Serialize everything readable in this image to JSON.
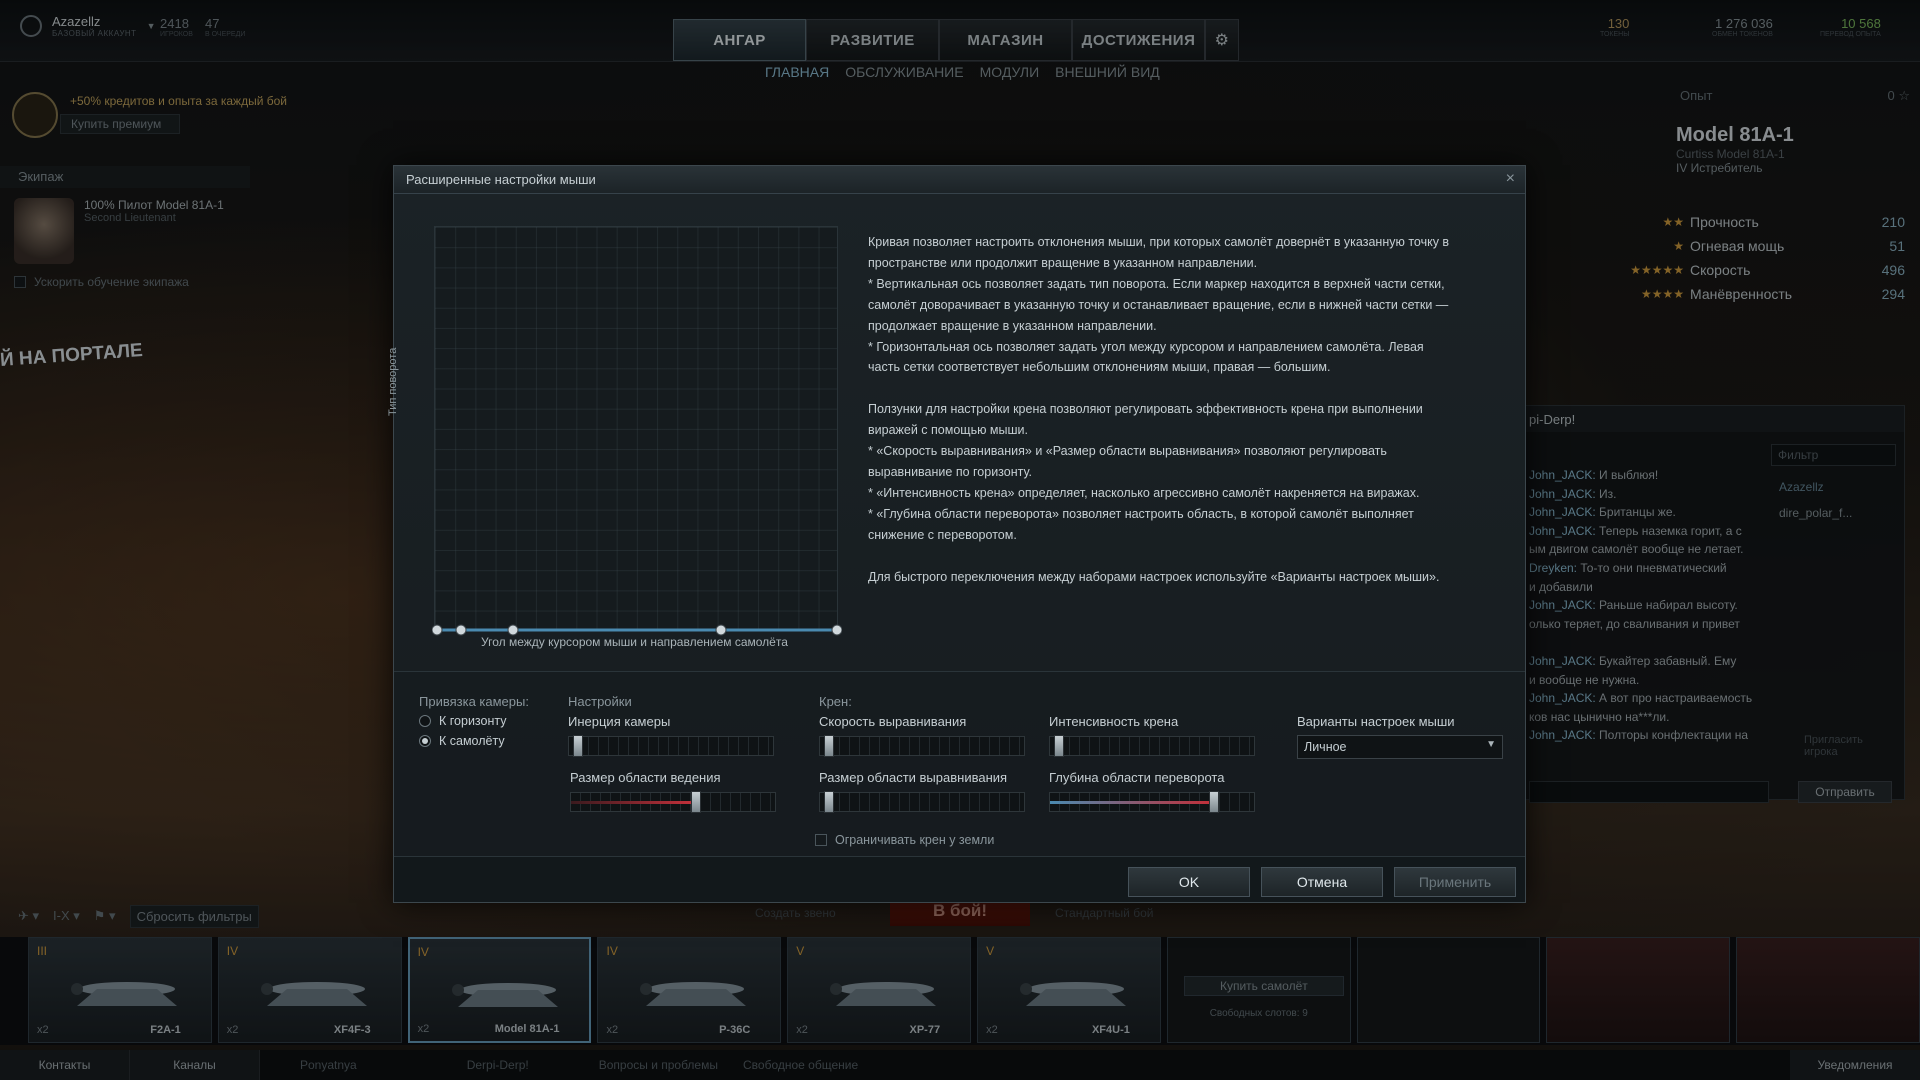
{
  "topbar": {
    "account_name": "Azazellz",
    "account_type": "БАЗОВЫЙ АККАУНТ",
    "stat1_value": "2418",
    "stat1_label": "ИГРОКОВ",
    "stat2_value": "47",
    "stat2_label": "В ОЧЕРЕДИ",
    "tabs": [
      "АНГАР",
      "РАЗВИТИЕ",
      "МАГАЗИН",
      "ДОСТИЖЕНИЯ"
    ],
    "subtabs": [
      "ГЛАВНАЯ",
      "ОБСЛУЖИВАНИЕ",
      "МОДУЛИ",
      "ВНЕШНИЙ ВИД"
    ],
    "tokens_value": "130",
    "tokens_label": "ТОКЕНЫ",
    "exchange_value": "1 276 036",
    "exchange_label": "ОБМЕН ТОКЕНОВ",
    "freexp_value": "10 568",
    "freexp_label": "ПЕРЕВОД ОПЫТА"
  },
  "premium": {
    "text": "+50% кредитов и опыта за каждый бой",
    "button": "Купить премиум"
  },
  "crew": {
    "title": "Экипаж",
    "pilot_line": "100%  Пилот Model 81A-1",
    "pilot_rank": "Second Lieutenant",
    "speedup": "Ускорить обучение экипажа"
  },
  "portal_text": "Й НА ПОРТАЛЕ",
  "plane_info": {
    "exp_label": "Опыт",
    "exp_value": "0 ☆",
    "name": "Model 81A-1",
    "full_name": "Curtiss Model 81A-1",
    "class": "IV Истребитель",
    "stats": [
      {
        "stars": "★★",
        "label": "Прочность",
        "value": "210"
      },
      {
        "stars": "★",
        "label": "Огневая мощь",
        "value": "51"
      },
      {
        "stars": "★★★★★",
        "label": "Скорость",
        "value": "496"
      },
      {
        "stars": "★★★★",
        "label": "Манёвренность",
        "value": "294"
      }
    ]
  },
  "chat": {
    "title": "pi-Derp!",
    "filter_placeholder": "Фильтр",
    "users": [
      "Azazellz",
      "dire_polar_f..."
    ],
    "invite": "Пригласить игрока",
    "send": "Отправить",
    "messages": [
      {
        "author": "John_JACK:",
        "text": "И выблюя!"
      },
      {
        "author": "John_JACK:",
        "text": "Из."
      },
      {
        "author": "John_JACK:",
        "text": "Британцы же."
      },
      {
        "author": "John_JACK:",
        "text": "Теперь наземка горит, а с"
      },
      {
        "author": "",
        "text": "ым двигом самолёт вообще не летает."
      },
      {
        "author": "Dreyken:",
        "text": "То-то они пневматический"
      },
      {
        "author": "",
        "text": "и добавили"
      },
      {
        "author": "John_JACK:",
        "text": "Раньше набирал высоту."
      },
      {
        "author": "",
        "text": "олько теряет, до сваливания и привет"
      },
      {
        "author": "",
        "text": ""
      },
      {
        "author": "John_JACK:",
        "text": "Букайтер забавный. Ему"
      },
      {
        "author": "",
        "text": "и вообще не нужна."
      },
      {
        "author": "John_JACK:",
        "text": "А вот про настраиваемость"
      },
      {
        "author": "",
        "text": "ков нас цынично на***ли."
      },
      {
        "author": "John_JACK:",
        "text": "Полторы конфлектации на"
      }
    ]
  },
  "dialog": {
    "title": "Расширенные настройки мыши",
    "close": "×",
    "y_axis": "Тип поворота",
    "x_axis": "Угол между курсором мыши и направлением самолёта",
    "help_text": "Кривая позволяет настроить отклонения мыши, при которых самолёт довернёт в указанную точку в\nпространстве или продолжит вращение в указанном направлении.\n* Вертикальная ось позволяет задать тип поворота. Если маркер находится в верхней части сетки,\nсамолёт доворачивает в указанную точку и останавливает вращение, если в нижней части сетки —\nпродолжает вращение в указанном направлении.\n* Горизонтальная ось позволяет задать угол между курсором и направлением самолёта. Левая\nчасть сетки соответствует небольшим отклонениям мыши, правая — большим.\n\nПолзунки для настройки крена позволяют регулировать эффективность крена при выполнении\nвиражей с помощью мыши.\n* «Скорость выравнивания» и «Размер области выравнивания» позволяют регулировать\nвыравнивание по горизонту.\n* «Интенсивность крена» определяет, насколько агрессивно самолёт накреняется на виражах.\n* «Глубина области переворота» позволяет настроить область, в которой самолёт выполняет\nснижение с переворотом.\n\nДля быстрого переключения между наборами настроек используйте «Варианты настроек мыши».",
    "camera_label": "Привязка камеры:",
    "camera_horizon": "К горизонту",
    "camera_plane": "К самолёту",
    "settings_label": "Настройки",
    "inertia_label": "Инерция камеры",
    "guide_label": "Размер области ведения",
    "roll_label": "Крен:",
    "align_speed_label": "Скорость выравнивания",
    "align_size_label": "Размер области выравнивания",
    "roll_intensity_label": "Интенсивность крена",
    "flip_depth_label": "Глубина области переворота",
    "limit_roll_label": "Ограничивать крен у земли",
    "presets_label": "Варианты настроек мыши",
    "preset_value": "Личное",
    "ok": "OK",
    "cancel": "Отмена",
    "apply": "Применить",
    "sliders": {
      "inertia": 0.02,
      "guide": 0.62,
      "align_speed": 0.02,
      "align_size": 0.02,
      "roll_intensity": 0.02,
      "flip_depth": 0.82
    }
  },
  "curve_points": [
    0.0,
    0.06,
    0.19,
    0.71,
    1.0
  ],
  "filterbar": {
    "reset": "Сбросить фильтры",
    "create": "Создать звено",
    "battle": "В бой!",
    "mode": "Стандартный бой"
  },
  "planes": [
    {
      "tier": "III",
      "name": "F2A-1",
      "count": "x2"
    },
    {
      "tier": "IV",
      "name": "XF4F-3",
      "count": "x2"
    },
    {
      "tier": "IV",
      "name": "Model 81A-1",
      "count": "x2"
    },
    {
      "tier": "IV",
      "name": "P-36C",
      "count": "x2"
    },
    {
      "tier": "V",
      "name": "XP-77",
      "count": "x2"
    },
    {
      "tier": "V",
      "name": "XF4U-1",
      "count": "x2"
    }
  ],
  "buy_slot": {
    "button": "Купить самолёт",
    "slots": "Свободных слотов: 9"
  },
  "footer": {
    "contacts": "Контакты",
    "channels": "Каналы",
    "chans": [
      "Ponyatnya",
      "Derpi-Derp!",
      "Вопросы и проблемы",
      "Свободное общение"
    ],
    "notifications": "Уведомления"
  },
  "colors": {
    "accent": "#8fc0d8",
    "red_slider": "#c0303a",
    "blue_slider": "#4a8ab0"
  }
}
